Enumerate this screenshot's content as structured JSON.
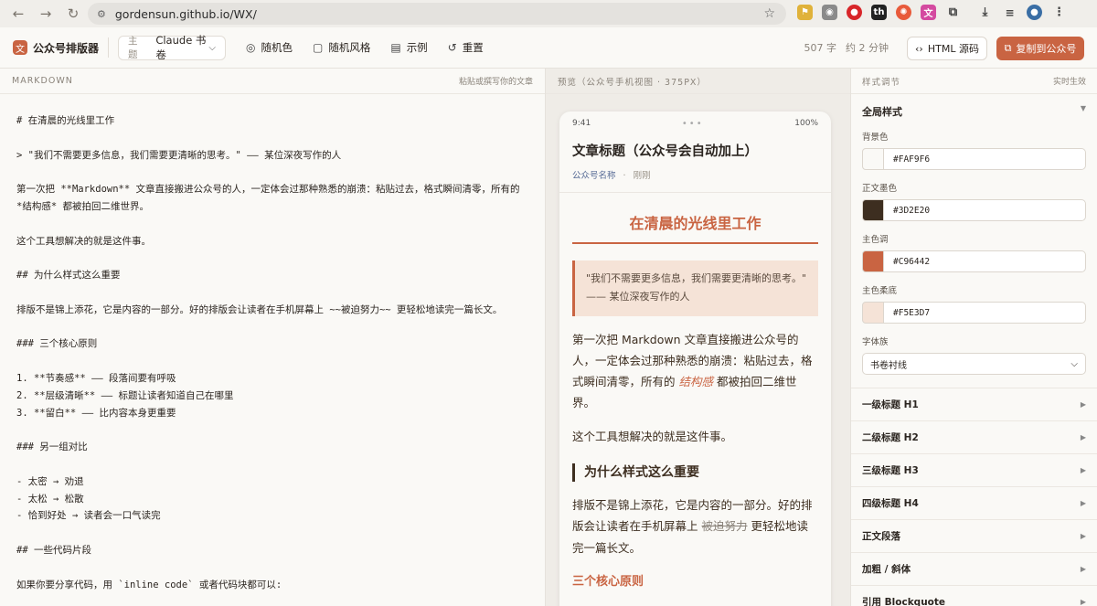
{
  "browser": {
    "url": "gordensun.github.io/WX/"
  },
  "toolbar": {
    "app_name": "公众号排版器",
    "theme_label": "主题",
    "theme_value": "Claude 书卷",
    "random_color": "随机色",
    "random_style": "随机风格",
    "example": "示例",
    "reset": "重置",
    "word_count": "507 字",
    "read_time": "约 2 分钟",
    "html_source": "HTML 源码",
    "copy_to_wechat": "复制到公众号"
  },
  "editor": {
    "title": "MARKDOWN",
    "hint": "粘贴或撰写你的文章",
    "lines": [
      "# 在清晨的光线里工作",
      "",
      "> \"我们不需要更多信息，我们需要更清晰的思考。\" —— 某位深夜写作的人",
      "",
      "第一次把 **Markdown** 文章直接搬进公众号的人，一定体会过那种熟悉的崩溃：粘贴过去，格式瞬间清零，所有的",
      "*结构感* 都被拍回二维世界。",
      "",
      "这个工具想解决的就是这件事。",
      "",
      "## 为什么样式这么重要",
      "",
      "排版不是锦上添花，它是内容的一部分。好的排版会让读者在手机屏幕上 ~~被迫努力~~ 更轻松地读完一篇长文。",
      "",
      "### 三个核心原则",
      "",
      "1. **节奏感** —— 段落间要有呼吸",
      "2. **层级清晰** —— 标题让读者知道自己在哪里",
      "3. **留白** —— 比内容本身更重要",
      "",
      "### 另一组对比",
      "",
      "- 太密 → 劝退",
      "- 太松 → 松散",
      "- 恰到好处 → 读者会一口气读完",
      "",
      "## 一些代码片段",
      "",
      "如果你要分享代码，用 `inline code` 或者代码块都可以:"
    ]
  },
  "preview": {
    "title": "预览（公众号手机视图 · 375PX）",
    "status_time": "9:41",
    "status_battery": "100%",
    "article_title": "文章标题（公众号会自动加上）",
    "account_name": "公众号名称",
    "meta_sep": "·",
    "meta_time": "刚刚",
    "h1": "在清晨的光线里工作",
    "quote": "\"我们不需要更多信息，我们需要更清晰的思考。\" —— 某位深夜写作的人",
    "p1_a": "第一次把 Markdown 文章直接搬进公众号的人，一定体会过那种熟悉的崩溃：粘贴过去，格式瞬间清零，所有的 ",
    "p1_em": "结构感",
    "p1_b": " 都被拍回二维世界。",
    "p2": "这个工具想解决的就是这件事。",
    "h2": "为什么样式这么重要",
    "p3_a": "排版不是锦上添花，它是内容的一部分。好的排版会让读者在手机屏幕上 ",
    "p3_del": "被迫努力",
    "p3_b": " 更轻松地读完一篇长文。",
    "h3": "三个核心原则"
  },
  "styles": {
    "title": "样式调节",
    "hint": "实时生效",
    "global_title": "全局样式",
    "fields": [
      {
        "label": "背景色",
        "value": "#FAF9F6",
        "color": "#FAF9F6"
      },
      {
        "label": "正文墨色",
        "value": "#3D2E20",
        "color": "#3D2E20"
      },
      {
        "label": "主色调",
        "value": "#C96442",
        "color": "#C96442"
      },
      {
        "label": "主色柔底",
        "value": "#F5E3D7",
        "color": "#F5E3D7"
      }
    ],
    "font_label": "字体族",
    "font_value": "书卷衬线",
    "sections": [
      "一级标题 H1",
      "二级标题 H2",
      "三级标题 H3",
      "四级标题 H4",
      "正文段落",
      "加粗 / 斜体",
      "引用 Blockquote"
    ]
  }
}
